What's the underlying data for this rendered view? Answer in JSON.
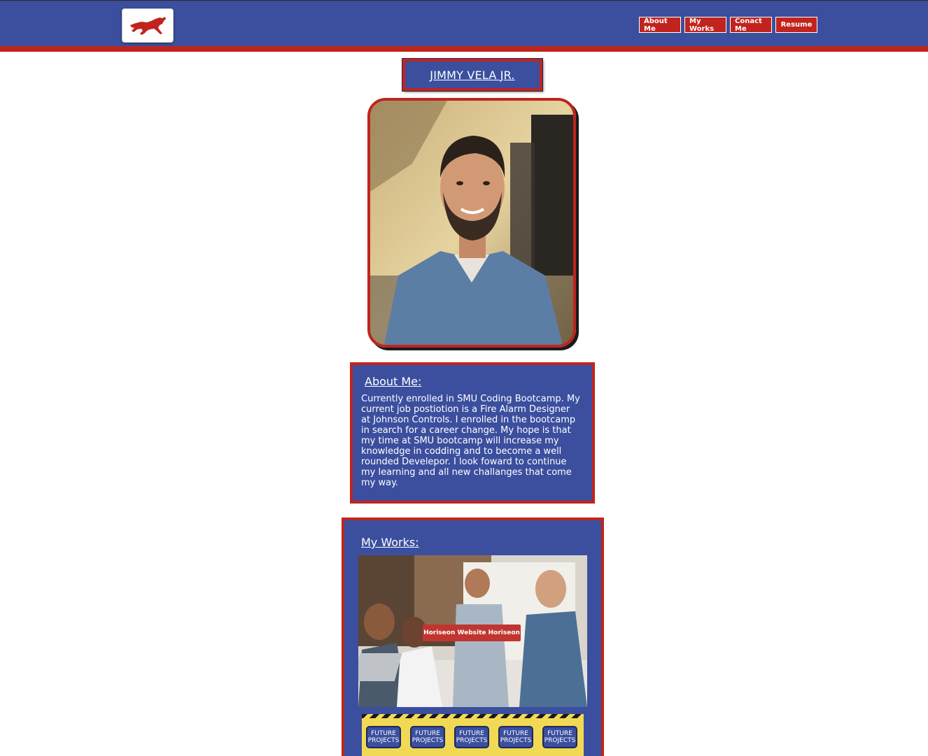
{
  "nav": {
    "items": [
      {
        "label": "About Me"
      },
      {
        "label": "My Works"
      },
      {
        "label": "Conact Me"
      },
      {
        "label": "Resume"
      }
    ]
  },
  "profile": {
    "name": "JIMMY VELA JR."
  },
  "about": {
    "title": "About Me:",
    "text": "Currently enrolled in SMU Coding Bootcamp. My current job postiotion is a Fire Alarm Designer at Johnson Controls. I enrolled in the bootcamp in search for a career change. My hope is that my time at SMU bootcamp will increase my knowledge in codding and to become a well rounded Develepor. I look foward to continue my learning and all new challanges that come my way."
  },
  "works": {
    "title": "My Works:",
    "featured_label": "Horiseon Website Horiseon",
    "future_items": [
      {
        "line1": "FUTURE",
        "line2": "PROJECTS"
      },
      {
        "line1": "FUTURE",
        "line2": "PROJECTS"
      },
      {
        "line1": "FUTURE",
        "line2": "PROJECTS"
      },
      {
        "line1": "FUTURE",
        "line2": "PROJECTS"
      },
      {
        "line1": "FUTURE",
        "line2": "PROJECTS"
      }
    ]
  },
  "colors": {
    "primary_blue": "#3b4f9e",
    "accent_red": "#c0241d"
  }
}
